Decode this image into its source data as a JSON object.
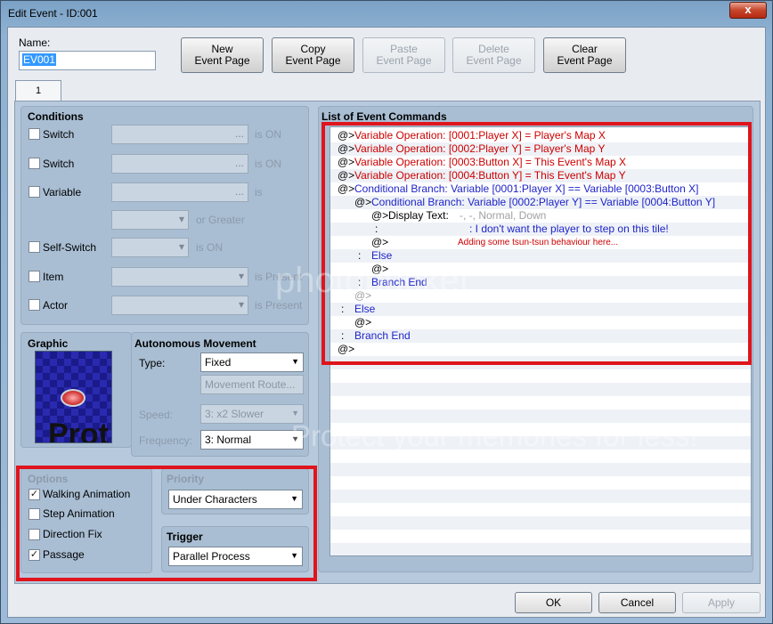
{
  "window": {
    "title": "Edit Event - ID:001",
    "close_label": "x"
  },
  "name": {
    "label": "Name:",
    "value": "EV001"
  },
  "toolbar": [
    {
      "line1": "New",
      "line2": "Event Page",
      "enabled": true
    },
    {
      "line1": "Copy",
      "line2": "Event Page",
      "enabled": true
    },
    {
      "line1": "Paste",
      "line2": "Event Page",
      "enabled": false
    },
    {
      "line1": "Delete",
      "line2": "Event Page",
      "enabled": false
    },
    {
      "line1": "Clear",
      "line2": "Event Page",
      "enabled": true
    }
  ],
  "tab": {
    "label": "1"
  },
  "conditions": {
    "title": "Conditions",
    "rows": [
      {
        "label": "Switch",
        "suffix": "is ON"
      },
      {
        "label": "Switch",
        "suffix": "is ON"
      },
      {
        "label": "Variable",
        "suffix": "is"
      },
      {
        "label": "",
        "suffix": "or Greater"
      },
      {
        "label": "Self-Switch",
        "suffix": "is ON"
      },
      {
        "label": "Item",
        "suffix": "is Present"
      },
      {
        "label": "Actor",
        "suffix": "is Present"
      }
    ]
  },
  "graphic": {
    "title": "Graphic",
    "overlay_text": "Prot"
  },
  "autonomous": {
    "title": "Autonomous Movement",
    "type_label": "Type:",
    "type_value": "Fixed",
    "route_button": "Movement Route...",
    "speed_label": "Speed:",
    "speed_value": "3: x2 Slower",
    "frequency_label": "Frequency:",
    "frequency_value": "3: Normal"
  },
  "options": {
    "title": "Options",
    "items": [
      {
        "label": "Walking Animation",
        "checked": true
      },
      {
        "label": "Step Animation",
        "checked": false
      },
      {
        "label": "Direction Fix",
        "checked": false
      },
      {
        "label": "Passage",
        "checked": true
      }
    ]
  },
  "priority": {
    "title": "Priority",
    "value": "Under Characters"
  },
  "trigger": {
    "title": "Trigger",
    "value": "Parallel Process"
  },
  "commands": {
    "title": "List of Event Commands",
    "lines": [
      {
        "prefix": "@>",
        "text": "Variable Operation: [0001:Player X] = Player's Map X",
        "color": "red",
        "indent": 0
      },
      {
        "prefix": "@>",
        "text": "Variable Operation: [0002:Player Y] = Player's Map Y",
        "color": "red",
        "indent": 0
      },
      {
        "prefix": "@>",
        "text": "Variable Operation: [0003:Button X] = This Event's Map X",
        "color": "red",
        "indent": 0
      },
      {
        "prefix": "@>",
        "text": "Variable Operation: [0004:Button Y] = This Event's Map Y",
        "color": "red",
        "indent": 0
      },
      {
        "prefix": "@>",
        "text": "Conditional Branch: Variable [0001:Player X] == Variable [0003:Button X]",
        "color": "blue",
        "indent": 0
      },
      {
        "prefix": "@>",
        "text": "Conditional Branch: Variable [0002:Player Y] == Variable [0004:Button Y]",
        "color": "blue",
        "indent": 1
      },
      {
        "prefix": "@>",
        "text": "Display Text: ",
        "extra": "-, -, Normal, Down",
        "color": "black",
        "indent": 2
      },
      {
        "prefix": ":",
        "text": ": I don't want the player to step on this tile!",
        "color": "blue",
        "indent": 2
      },
      {
        "prefix": "@>",
        "text": "Adding some tsun-tsun behaviour here...",
        "color": "red-small",
        "indent": 2
      },
      {
        "prefix": ":",
        "text": "Else",
        "color": "blue",
        "indent": 1
      },
      {
        "prefix": "@>",
        "text": "",
        "color": "black",
        "indent": 2
      },
      {
        "prefix": ":",
        "text": "Branch End",
        "color": "blue",
        "indent": 1
      },
      {
        "prefix": "@>",
        "text": "",
        "color": "gray",
        "indent": 1
      },
      {
        "prefix": ":",
        "text": "Else",
        "color": "blue",
        "indent": 0
      },
      {
        "prefix": "@>",
        "text": "",
        "color": "black",
        "indent": 1
      },
      {
        "prefix": ":",
        "text": "Branch End",
        "color": "blue",
        "indent": 0
      },
      {
        "prefix": "@>",
        "text": "",
        "color": "black",
        "indent": -1
      }
    ]
  },
  "footer": {
    "ok": "OK",
    "cancel": "Cancel",
    "apply": "Apply"
  },
  "watermark": {
    "logo": "photobucket",
    "tagline": "Protect your memories for less!"
  },
  "colors": {
    "highlight": "#e0141c",
    "red": "#cc0000",
    "blue": "#1f24c8"
  }
}
